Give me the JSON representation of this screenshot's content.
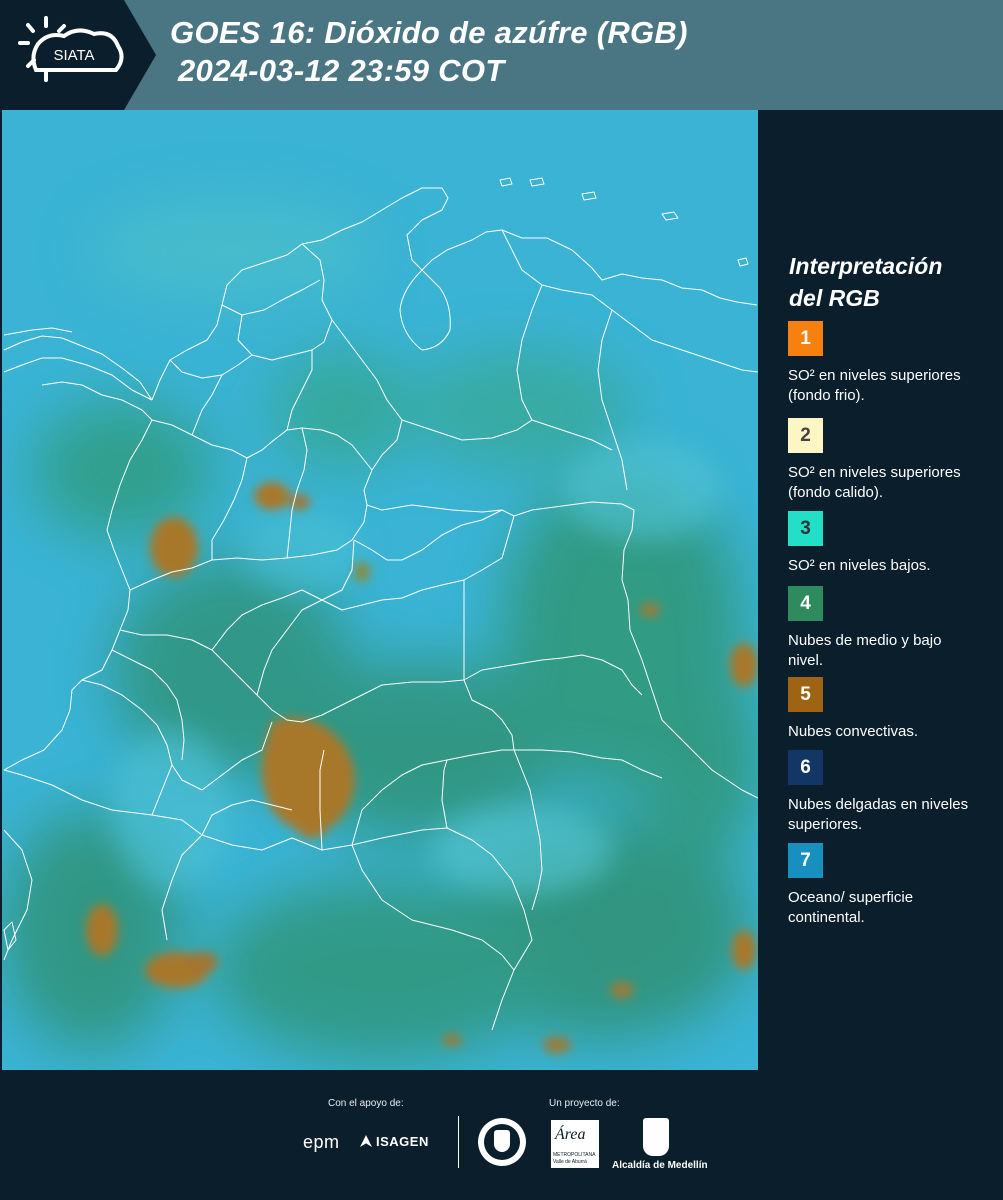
{
  "header": {
    "logo_text": "SIATA",
    "title_line1": "GOES 16: Dióxido de azúfre (RGB)",
    "title_line2": "2024-03-12 23:59 COT"
  },
  "legend": {
    "title_line1": "Interpretación",
    "title_line2": "del RGB",
    "items": [
      {
        "number": "1",
        "color": "#f7800e",
        "number_color": "#ffffff",
        "text": "SO² en niveles superiores (fondo frio)."
      },
      {
        "number": "2",
        "color": "#fcf5c4",
        "number_color": "#444444",
        "text": "SO² en niveles superiores (fondo calido)."
      },
      {
        "number": "3",
        "color": "#22e0c8",
        "number_color": "#333333",
        "text": "SO² en niveles bajos."
      },
      {
        "number": "4",
        "color": "#2f8a5e",
        "number_color": "#ffffff",
        "text": "Nubes de medio y bajo nivel."
      },
      {
        "number": "5",
        "color": "#9e6413",
        "number_color": "#ffffff",
        "text": "Nubes convectivas."
      },
      {
        "number": "6",
        "color": "#123766",
        "number_color": "#ffffff",
        "text": "Nubes delgadas en niveles superiores."
      },
      {
        "number": "7",
        "color": "#1790bf",
        "number_color": "#ffffff",
        "text": "Oceano/ superficie continental."
      }
    ]
  },
  "footer": {
    "support_label": "Con el apoyo de:",
    "project_label": "Un proyecto de:",
    "sponsor_epm": "epm",
    "sponsor_isagen": "ISAGEN",
    "area_logo_text": "Área",
    "area_caption1": "METROPOLITANA",
    "area_caption2": "Valle de Aburrá",
    "alcaldia_caption": "Alcaldía de Medellín"
  },
  "colors": {
    "header_bg": "#4a7684",
    "panel_bg": "#0b1e2b",
    "ocean": "#3ab3d4",
    "convective": "#a8782a"
  }
}
